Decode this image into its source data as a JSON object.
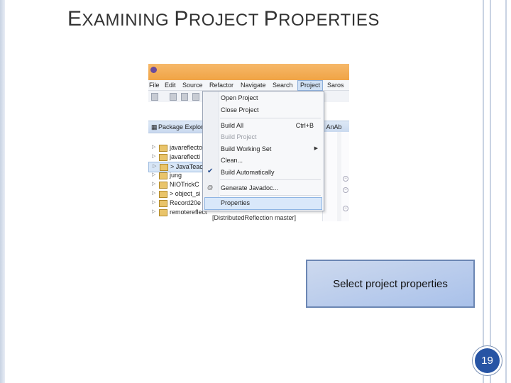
{
  "slide": {
    "title_first_letter_1": "E",
    "title_rest_1": "XAMINING ",
    "title_first_letter_2": "P",
    "title_rest_2": "ROJECT ",
    "title_first_letter_3": "P",
    "title_rest_3": "ROPERTIES",
    "callout_text": "Select project properties",
    "page_number": "19"
  },
  "menubar": {
    "items": [
      "File",
      "Edit",
      "Source",
      "Refactor",
      "Navigate",
      "Search",
      "Project",
      "Saros"
    ],
    "active": "Project"
  },
  "package_explorer": {
    "tab_label": "Package Explor",
    "right_tab_label": "] AnAb",
    "items": [
      {
        "label": "javareflecto"
      },
      {
        "label": "javareflecti"
      },
      {
        "label": "> JavaTeac"
      },
      {
        "label": "jung"
      },
      {
        "label": "NIOTrickC"
      },
      {
        "label": "> object_si"
      },
      {
        "label": "Record20e"
      },
      {
        "label": "remotereflect"
      }
    ],
    "footer_suffix": "[DistributedReflection master]"
  },
  "project_menu": {
    "items": [
      {
        "label": "Open Project",
        "enabled": true
      },
      {
        "label": "Close Project",
        "enabled": true
      },
      {
        "label": "Build All",
        "enabled": false,
        "shortcut": "Ctrl+B"
      },
      {
        "label": "Build Project",
        "enabled": false
      },
      {
        "label": "Build Working Set",
        "enabled": true,
        "submenu": true
      },
      {
        "label": "Clean...",
        "enabled": true
      },
      {
        "label": "Build Automatically",
        "enabled": true,
        "checked": true
      },
      {
        "label": "Generate Javadoc...",
        "enabled": true
      },
      {
        "label": "Properties",
        "enabled": true,
        "highlighted": true
      }
    ]
  },
  "colors": {
    "accent": "#2754a4",
    "callout_fill": "#b7cbec",
    "callout_border": "#6b86b3",
    "title_text": "#333333"
  }
}
